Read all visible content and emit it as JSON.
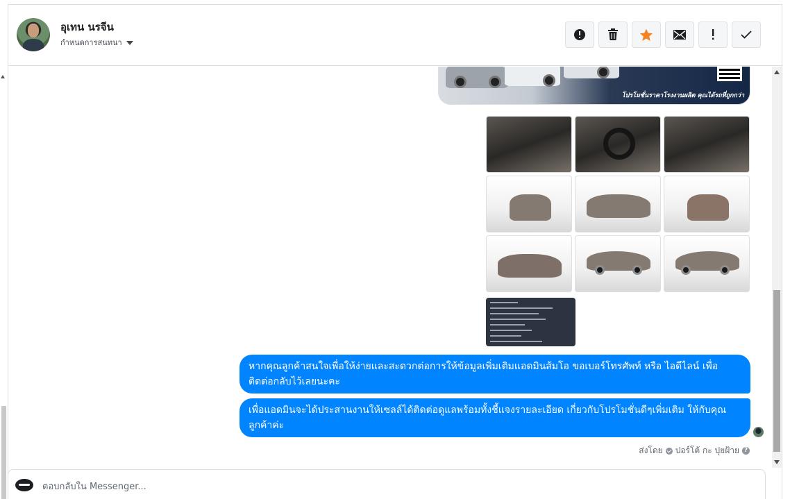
{
  "header": {
    "contact_name": "อุเทน นรจีน",
    "assign_label": "กำหนดการสนทนา"
  },
  "toolbar": {
    "buttons": [
      {
        "name": "report-spam",
        "icon": "alert-circle-icon"
      },
      {
        "name": "delete",
        "icon": "trash-icon"
      },
      {
        "name": "star",
        "icon": "star-icon"
      },
      {
        "name": "mark-unread",
        "icon": "envelope-icon"
      },
      {
        "name": "important",
        "icon": "exclamation-icon"
      },
      {
        "name": "mark-done",
        "icon": "checkmark-icon"
      }
    ],
    "star_color": "#f5821f"
  },
  "conversation": {
    "banner_promo_text": "โปรโมชั่นราคาโรงงานผลิต คุณได้รถที่ถูกกว่า",
    "messages": [
      "หากคุณลูกค้าสนใจเพื่อให้ง่ายและสะดวกต่อการให้ข้อมูลเพิ่มเติมแอดมินส้มโอ ขอเบอร์โทรศัพท์ หรือ ไอดีไลน์ เพื่อติดต่อกลับไว้เลยนะคะ",
      "เพื่อแอดมินจะได้ประสานงานให้เซลล์ได้ติดต่อดูแลพร้อมทั้งชี้แจงรายละเอียด เกี่ยวกับโปรโมชั่นดีๆเพิ่มเติม ให้กับคุณลูกค้าค่ะ"
    ],
    "bubble_color": "#0084ff",
    "sent_by_label": "ส่งโดย",
    "sender_name": "ปอร์โต้ กะ ปุยฝ้าย"
  },
  "reply": {
    "placeholder": "ตอบกลับใน Messenger..."
  }
}
